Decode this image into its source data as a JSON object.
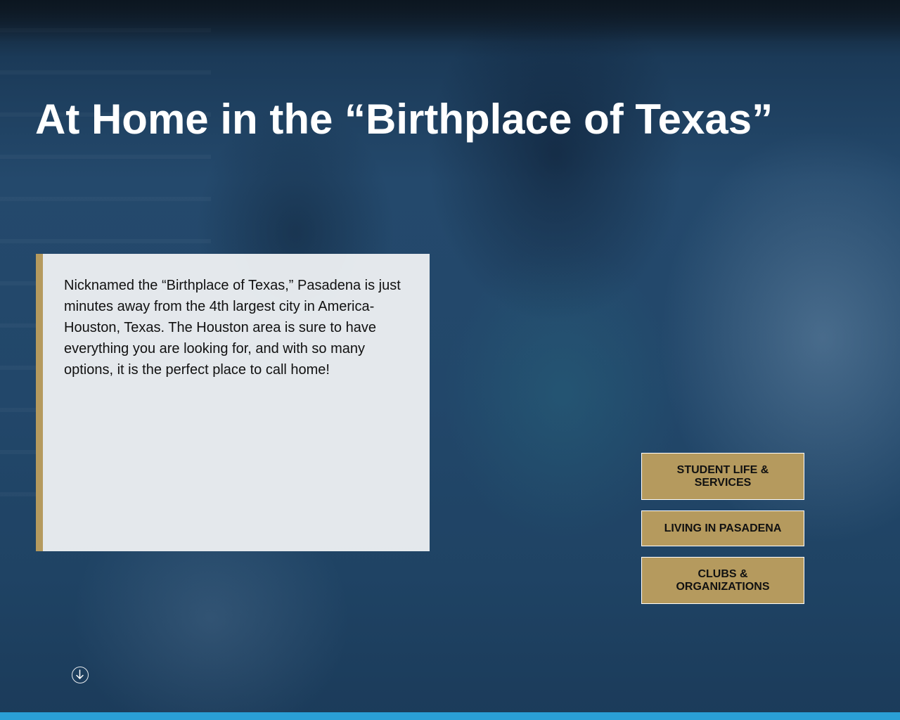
{
  "hero": {
    "headline": "At Home in the “Birthplace of Texas”"
  },
  "info_card": {
    "text": "Nicknamed the “Birthplace of Texas,” Pasadena is just minutes away from the 4th largest city in America- Houston, Texas. The Houston area is sure to have everything you are looking for, and with so many options, it is the perfect place to call home!"
  },
  "nav_buttons": {
    "student_life": "Student Life & Services",
    "living": "Living in Pasadena",
    "clubs": "Clubs & Organizations"
  },
  "icons": {
    "scroll": "arrow-down-circle-icon"
  },
  "colors": {
    "accent_gold": "#b59a5e",
    "overlay_navy": "#1d3e5e",
    "bottom_bar_blue": "#2a9fd6",
    "card_bg": "#f0f2f4"
  }
}
